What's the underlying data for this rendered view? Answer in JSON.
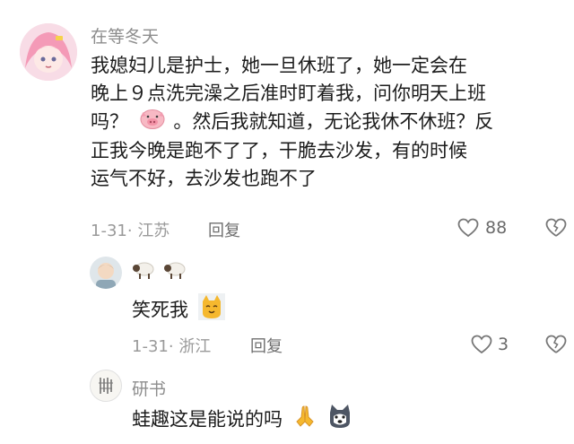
{
  "comments": [
    {
      "username": "在等冬天",
      "lines": [
        "我媳妇儿是护士，她一旦休班了，她一定会在",
        "晚上９点洗完澡之后准时盯着我，问你明天上班",
        "吗？",
        "。然后我就知道，无论我休不休班？反",
        "正我今晚是跑不了了，干脆去沙发，有的时候",
        "运气不好，去沙发也跑不了"
      ],
      "date": "1-31",
      "location": "江苏",
      "reply_label": "回复",
      "likes": "88",
      "emoji": "pig-face-emoji"
    },
    {
      "username": "",
      "name_emojis": [
        "sheep-emoji",
        "sheep-emoji"
      ],
      "text": "笑死我",
      "emoji": "cat-emoji",
      "date": "1-31",
      "location": "浙江",
      "reply_label": "回复",
      "likes": "3"
    },
    {
      "username": "研书",
      "text": "蛙趣这是能说的吗",
      "emojis": [
        "praying-hands-emoji",
        "husky-dog-emoji"
      ]
    }
  ],
  "colors": {
    "text": "#1c1c1c",
    "meta": "#9a9a9a",
    "username": "#8d8d8d",
    "emoji_pink": "#f4b6c2",
    "emoji_yellow": "#f5b82e"
  }
}
